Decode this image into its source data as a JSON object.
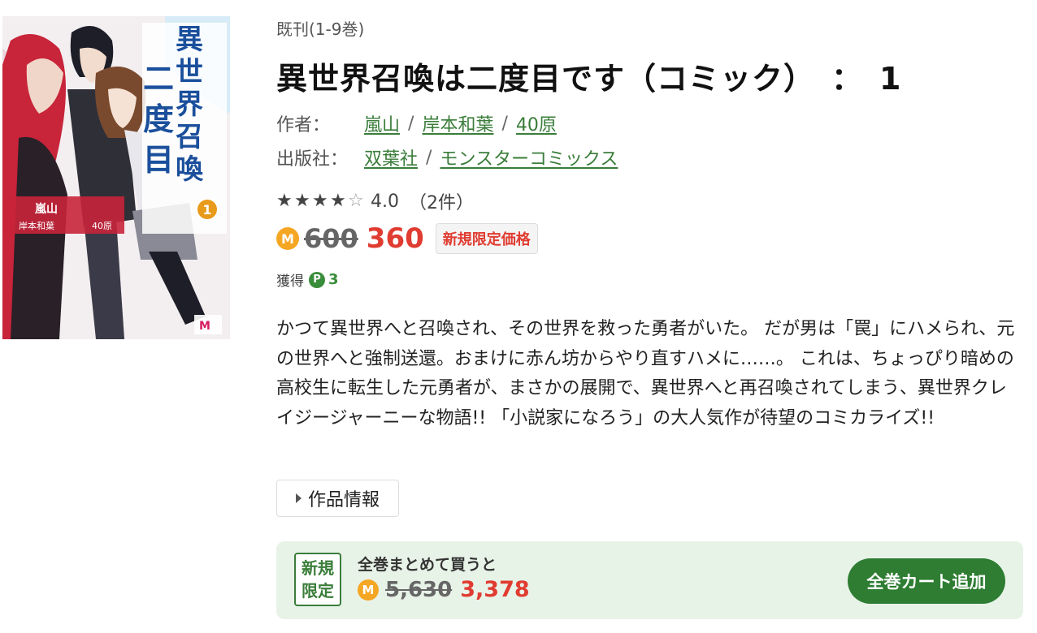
{
  "cover": {
    "title_text": "異世界召喚は二度目です",
    "volume": "1",
    "credits": [
      "嵐山",
      "岸本和葉",
      "40原"
    ]
  },
  "series_label": "既刊(1-9巻)",
  "title": "異世界召喚は二度目です（コミック）　：　1",
  "authors": {
    "label": "作者：",
    "names": [
      "嵐山",
      "岸本和葉",
      "40原"
    ]
  },
  "publisher": {
    "label": "出版社：",
    "names": [
      "双葉社",
      "モンスターコミックス"
    ]
  },
  "rating": {
    "stars": 4,
    "max": 5,
    "score": "4.0",
    "count": "（2件）"
  },
  "price": {
    "coin_icon": "M",
    "original": "600",
    "sale": "360",
    "tag": "新規限定価格"
  },
  "points": {
    "label": "獲得",
    "icon": "P",
    "value": "3"
  },
  "description": "かつて異世界へと召喚され、その世界を救った勇者がいた。 だが男は「罠」にハメられ、元の世界へと強制送還。おまけに赤ん坊からやり直すハメに……。 これは、ちょっぴり暗めの高校生に転生した元勇者が、まさかの展開で、異世界へと再召喚されてしまう、異世界クレイジージャーニーな物語!! 「小説家になろう」の大人気作が待望のコミカライズ!!",
  "work_info_button": "作品情報",
  "bundle": {
    "badge_line1": "新規",
    "badge_line2": "限定",
    "text": "全巻まとめて買うと",
    "original": "5,630",
    "sale": "3,378",
    "button": "全巻カート追加"
  },
  "colors": {
    "accent_green": "#2e7d32",
    "sale_red": "#e03c31",
    "coin_orange": "#f5a623",
    "bundle_bg": "#e8f3e8"
  }
}
